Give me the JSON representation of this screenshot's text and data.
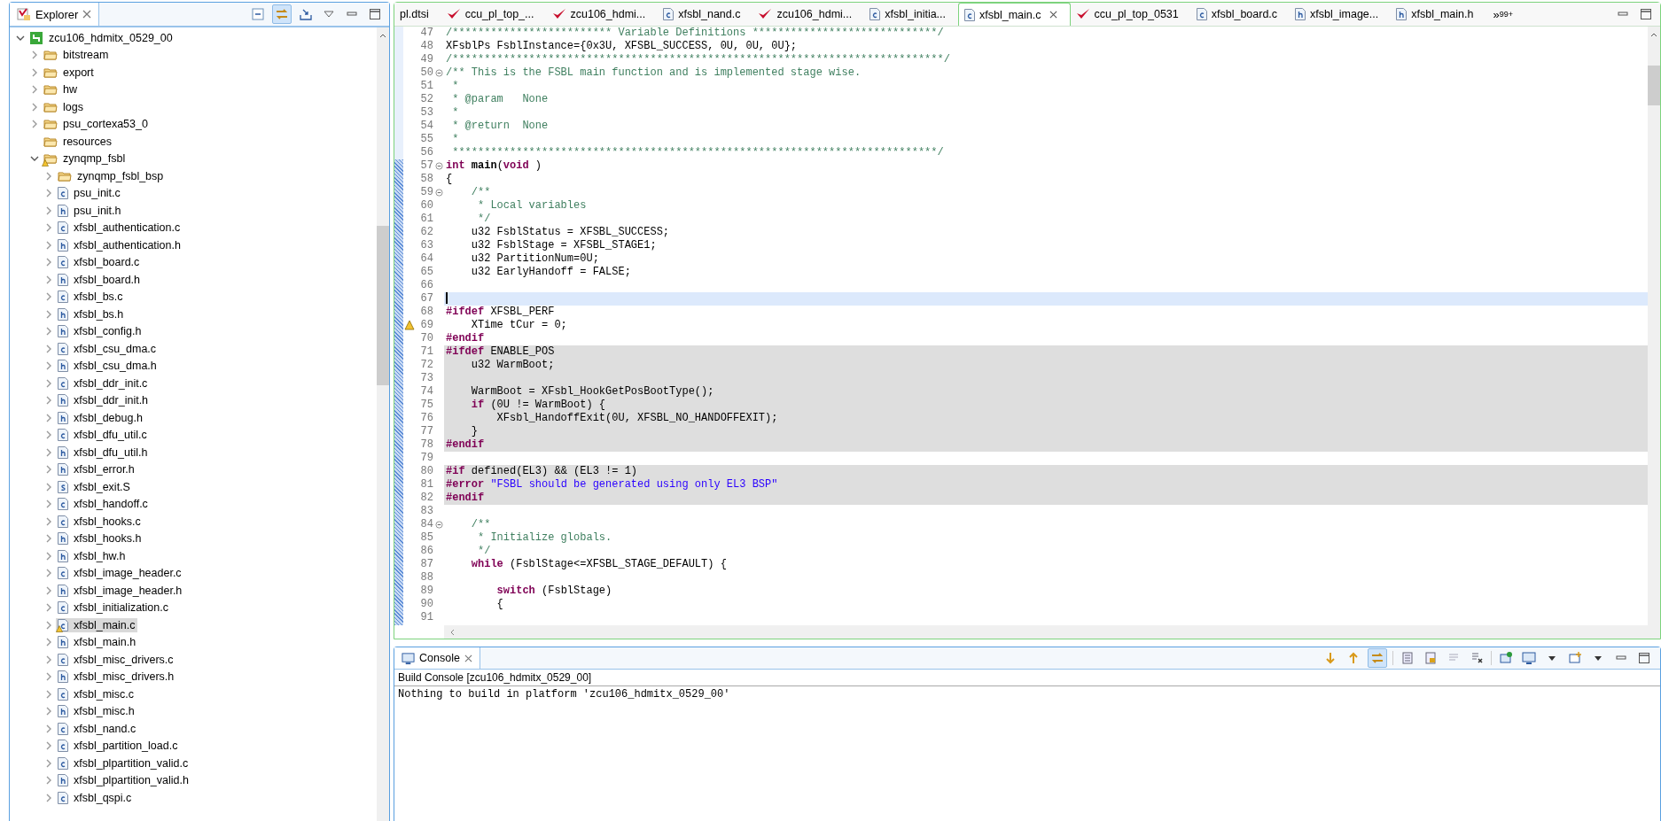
{
  "explorer": {
    "title": "Explorer",
    "tree": [
      {
        "label": "zcu106_hdmitx_0529_00",
        "kind": "project",
        "expanded": true,
        "selected": false,
        "warning": false,
        "children": [
          {
            "label": "bitstream",
            "kind": "folder",
            "expanded": false,
            "selected": false,
            "warning": false
          },
          {
            "label": "export",
            "kind": "folder",
            "expanded": false,
            "selected": false,
            "warning": false
          },
          {
            "label": "hw",
            "kind": "folder",
            "expanded": false,
            "selected": false,
            "warning": false
          },
          {
            "label": "logs",
            "kind": "folder",
            "expanded": false,
            "selected": false,
            "warning": false
          },
          {
            "label": "psu_cortexa53_0",
            "kind": "folder",
            "expanded": false,
            "selected": false,
            "warning": false
          },
          {
            "label": "resources",
            "kind": "folder",
            "selected": false,
            "warning": false
          },
          {
            "label": "zynqmp_fsbl",
            "kind": "folder",
            "expanded": true,
            "selected": false,
            "warning": true,
            "children": [
              {
                "label": "zynqmp_fsbl_bsp",
                "kind": "folder",
                "expanded": false,
                "selected": false,
                "warning": false
              },
              {
                "label": "psu_init.c",
                "kind": "c",
                "expanded": false,
                "selected": false,
                "warning": false
              },
              {
                "label": "psu_init.h",
                "kind": "h",
                "expanded": false,
                "selected": false,
                "warning": false
              },
              {
                "label": "xfsbl_authentication.c",
                "kind": "c",
                "expanded": false,
                "selected": false,
                "warning": false
              },
              {
                "label": "xfsbl_authentication.h",
                "kind": "h",
                "expanded": false,
                "selected": false,
                "warning": false
              },
              {
                "label": "xfsbl_board.c",
                "kind": "c",
                "expanded": false,
                "selected": false,
                "warning": false
              },
              {
                "label": "xfsbl_board.h",
                "kind": "h",
                "expanded": false,
                "selected": false,
                "warning": false
              },
              {
                "label": "xfsbl_bs.c",
                "kind": "c",
                "expanded": false,
                "selected": false,
                "warning": false
              },
              {
                "label": "xfsbl_bs.h",
                "kind": "h",
                "expanded": false,
                "selected": false,
                "warning": false
              },
              {
                "label": "xfsbl_config.h",
                "kind": "h",
                "expanded": false,
                "selected": false,
                "warning": false
              },
              {
                "label": "xfsbl_csu_dma.c",
                "kind": "c",
                "expanded": false,
                "selected": false,
                "warning": false
              },
              {
                "label": "xfsbl_csu_dma.h",
                "kind": "h",
                "expanded": false,
                "selected": false,
                "warning": false
              },
              {
                "label": "xfsbl_ddr_init.c",
                "kind": "c",
                "expanded": false,
                "selected": false,
                "warning": false
              },
              {
                "label": "xfsbl_ddr_init.h",
                "kind": "h",
                "expanded": false,
                "selected": false,
                "warning": false
              },
              {
                "label": "xfsbl_debug.h",
                "kind": "h",
                "expanded": false,
                "selected": false,
                "warning": false
              },
              {
                "label": "xfsbl_dfu_util.c",
                "kind": "c",
                "expanded": false,
                "selected": false,
                "warning": false
              },
              {
                "label": "xfsbl_dfu_util.h",
                "kind": "h",
                "expanded": false,
                "selected": false,
                "warning": false
              },
              {
                "label": "xfsbl_error.h",
                "kind": "h",
                "expanded": false,
                "selected": false,
                "warning": false
              },
              {
                "label": "xfsbl_exit.S",
                "kind": "s",
                "expanded": false,
                "selected": false,
                "warning": false
              },
              {
                "label": "xfsbl_handoff.c",
                "kind": "c",
                "expanded": false,
                "selected": false,
                "warning": false
              },
              {
                "label": "xfsbl_hooks.c",
                "kind": "c",
                "expanded": false,
                "selected": false,
                "warning": false
              },
              {
                "label": "xfsbl_hooks.h",
                "kind": "h",
                "expanded": false,
                "selected": false,
                "warning": false
              },
              {
                "label": "xfsbl_hw.h",
                "kind": "h",
                "expanded": false,
                "selected": false,
                "warning": false
              },
              {
                "label": "xfsbl_image_header.c",
                "kind": "c",
                "expanded": false,
                "selected": false,
                "warning": false
              },
              {
                "label": "xfsbl_image_header.h",
                "kind": "h",
                "expanded": false,
                "selected": false,
                "warning": false
              },
              {
                "label": "xfsbl_initialization.c",
                "kind": "c",
                "expanded": false,
                "selected": false,
                "warning": false
              },
              {
                "label": "xfsbl_main.c",
                "kind": "c",
                "expanded": false,
                "selected": true,
                "warning": true
              },
              {
                "label": "xfsbl_main.h",
                "kind": "h",
                "expanded": false,
                "selected": false,
                "warning": false
              },
              {
                "label": "xfsbl_misc_drivers.c",
                "kind": "c",
                "expanded": false,
                "selected": false,
                "warning": false
              },
              {
                "label": "xfsbl_misc_drivers.h",
                "kind": "h",
                "expanded": false,
                "selected": false,
                "warning": false
              },
              {
                "label": "xfsbl_misc.c",
                "kind": "c",
                "expanded": false,
                "selected": false,
                "warning": false
              },
              {
                "label": "xfsbl_misc.h",
                "kind": "h",
                "expanded": false,
                "selected": false,
                "warning": false
              },
              {
                "label": "xfsbl_nand.c",
                "kind": "c",
                "expanded": false,
                "selected": false,
                "warning": false
              },
              {
                "label": "xfsbl_partition_load.c",
                "kind": "c",
                "expanded": false,
                "selected": false,
                "warning": false
              },
              {
                "label": "xfsbl_plpartition_valid.c",
                "kind": "c",
                "expanded": false,
                "selected": false,
                "warning": false
              },
              {
                "label": "xfsbl_plpartition_valid.h",
                "kind": "h",
                "expanded": false,
                "selected": false,
                "warning": false
              },
              {
                "label": "xfsbl_qspi.c",
                "kind": "c",
                "expanded": false,
                "selected": false,
                "warning": false
              }
            ]
          }
        ]
      }
    ]
  },
  "editor": {
    "tabs": [
      {
        "label": "pl.dtsi",
        "kind": "plain",
        "selected": false
      },
      {
        "label": "ccu_pl_top_...",
        "kind": "design",
        "selected": false
      },
      {
        "label": "zcu106_hdmi...",
        "kind": "design",
        "selected": false
      },
      {
        "label": "xfsbl_nand.c",
        "kind": "c",
        "selected": false
      },
      {
        "label": "zcu106_hdmi...",
        "kind": "design",
        "selected": false
      },
      {
        "label": "xfsbl_initia...",
        "kind": "c",
        "selected": false
      },
      {
        "label": "xfsbl_main.c",
        "kind": "c",
        "selected": true
      },
      {
        "label": "ccu_pl_top_0531",
        "kind": "design",
        "selected": false
      },
      {
        "label": "xfsbl_board.c",
        "kind": "c",
        "selected": false
      },
      {
        "label": "xfsbl_image...",
        "kind": "h",
        "selected": false
      },
      {
        "label": "xfsbl_main.h",
        "kind": "h",
        "selected": false
      }
    ],
    "overflow": {
      "mark": "»",
      "count": "99+"
    },
    "lines": [
      {
        "number": "47",
        "segments": [
          {
            "kind": "comment",
            "text": "/************************* Variable Definitions *****************************/"
          }
        ],
        "fold": false,
        "shaded": false,
        "current": false,
        "warning": false
      },
      {
        "number": "48",
        "segments": [
          {
            "kind": "plain",
            "text": "XFsblPs FsblInstance={0x3U, XFSBL_SUCCESS, 0U, 0U, 0U};"
          }
        ],
        "fold": false,
        "shaded": false,
        "current": false,
        "warning": false
      },
      {
        "number": "49",
        "segments": [
          {
            "kind": "comment",
            "text": "/*****************************************************************************/"
          }
        ],
        "fold": false,
        "shaded": false,
        "current": false,
        "warning": false
      },
      {
        "number": "50",
        "segments": [
          {
            "kind": "comment",
            "text": "/** This is the FSBL main function and is implemented stage wise."
          }
        ],
        "fold": true,
        "shaded": false,
        "current": false,
        "warning": false
      },
      {
        "number": "51",
        "segments": [
          {
            "kind": "comment",
            "text": " *"
          }
        ],
        "fold": false,
        "shaded": false,
        "current": false,
        "warning": false
      },
      {
        "number": "52",
        "segments": [
          {
            "kind": "comment",
            "text": " * @param   None"
          }
        ],
        "fold": false,
        "shaded": false,
        "current": false,
        "warning": false
      },
      {
        "number": "53",
        "segments": [
          {
            "kind": "comment",
            "text": " *"
          }
        ],
        "fold": false,
        "shaded": false,
        "current": false,
        "warning": false
      },
      {
        "number": "54",
        "segments": [
          {
            "kind": "comment",
            "text": " * @return  None"
          }
        ],
        "fold": false,
        "shaded": false,
        "current": false,
        "warning": false
      },
      {
        "number": "55",
        "segments": [
          {
            "kind": "comment",
            "text": " *"
          }
        ],
        "fold": false,
        "shaded": false,
        "current": false,
        "warning": false
      },
      {
        "number": "56",
        "segments": [
          {
            "kind": "comment",
            "text": " ****************************************************************************/"
          }
        ],
        "fold": false,
        "shaded": false,
        "current": false,
        "warning": false
      },
      {
        "number": "57",
        "segments": [
          {
            "kind": "keyword",
            "text": "int"
          },
          {
            "kind": "declaration",
            "text": " main"
          },
          {
            "kind": "plain",
            "text": "("
          },
          {
            "kind": "keyword",
            "text": "void"
          },
          {
            "kind": "plain",
            "text": " )"
          }
        ],
        "fold": true,
        "shaded": false,
        "current": false,
        "warning": false
      },
      {
        "number": "58",
        "segments": [
          {
            "kind": "plain",
            "text": "{"
          }
        ],
        "fold": false,
        "shaded": false,
        "current": false,
        "warning": false
      },
      {
        "number": "59",
        "segments": [
          {
            "kind": "comment",
            "text": "    /**"
          }
        ],
        "fold": true,
        "shaded": false,
        "current": false,
        "warning": false
      },
      {
        "number": "60",
        "segments": [
          {
            "kind": "comment",
            "text": "     * Local variables"
          }
        ],
        "fold": false,
        "shaded": false,
        "current": false,
        "warning": false
      },
      {
        "number": "61",
        "segments": [
          {
            "kind": "comment",
            "text": "     */"
          }
        ],
        "fold": false,
        "shaded": false,
        "current": false,
        "warning": false
      },
      {
        "number": "62",
        "segments": [
          {
            "kind": "plain",
            "text": "    u32 FsblStatus = XFSBL_SUCCESS;"
          }
        ],
        "fold": false,
        "shaded": false,
        "current": false,
        "warning": false
      },
      {
        "number": "63",
        "segments": [
          {
            "kind": "plain",
            "text": "    u32 FsblStage = XFSBL_STAGE1;"
          }
        ],
        "fold": false,
        "shaded": false,
        "current": false,
        "warning": false
      },
      {
        "number": "64",
        "segments": [
          {
            "kind": "plain",
            "text": "    u32 PartitionNum=0U;"
          }
        ],
        "fold": false,
        "shaded": false,
        "current": false,
        "warning": false
      },
      {
        "number": "65",
        "segments": [
          {
            "kind": "plain",
            "text": "    u32 EarlyHandoff = FALSE;"
          }
        ],
        "fold": false,
        "shaded": false,
        "current": false,
        "warning": false
      },
      {
        "number": "66",
        "fold": false,
        "shaded": false,
        "current": false,
        "warning": false
      },
      {
        "number": "67",
        "fold": false,
        "shaded": false,
        "current": true,
        "warning": false
      },
      {
        "number": "68",
        "segments": [
          {
            "kind": "directive",
            "text": "#ifdef"
          },
          {
            "kind": "plain",
            "text": " XFSBL_PERF"
          }
        ],
        "fold": false,
        "shaded": false,
        "current": false,
        "warning": false
      },
      {
        "number": "69",
        "segments": [
          {
            "kind": "plain",
            "text": "    XTime tCur = 0;"
          }
        ],
        "fold": false,
        "shaded": false,
        "current": false,
        "warning": true
      },
      {
        "number": "70",
        "segments": [
          {
            "kind": "directive",
            "text": "#endif"
          }
        ],
        "fold": false,
        "shaded": false,
        "current": false,
        "warning": false
      },
      {
        "number": "71",
        "segments": [
          {
            "kind": "directive",
            "text": "#ifdef"
          },
          {
            "kind": "plain",
            "text": " ENABLE_POS"
          }
        ],
        "fold": false,
        "shaded": true,
        "current": false,
        "warning": false
      },
      {
        "number": "72",
        "segments": [
          {
            "kind": "plain",
            "text": "    u32 WarmBoot;"
          }
        ],
        "fold": false,
        "shaded": true,
        "current": false,
        "warning": false
      },
      {
        "number": "73",
        "fold": false,
        "shaded": true,
        "current": false,
        "warning": false
      },
      {
        "number": "74",
        "segments": [
          {
            "kind": "plain",
            "text": "    WarmBoot = XFsbl_HookGetPosBootType();"
          }
        ],
        "fold": false,
        "shaded": true,
        "current": false,
        "warning": false
      },
      {
        "number": "75",
        "segments": [
          {
            "kind": "keyword",
            "text": "    if"
          },
          {
            "kind": "plain",
            "text": " (0U != WarmBoot) {"
          }
        ],
        "fold": false,
        "shaded": true,
        "current": false,
        "warning": false
      },
      {
        "number": "76",
        "segments": [
          {
            "kind": "plain",
            "text": "        XFsbl_HandoffExit(0U, XFSBL_NO_HANDOFFEXIT);"
          }
        ],
        "fold": false,
        "shaded": true,
        "current": false,
        "warning": false
      },
      {
        "number": "77",
        "segments": [
          {
            "kind": "plain",
            "text": "    }"
          }
        ],
        "fold": false,
        "shaded": true,
        "current": false,
        "warning": false
      },
      {
        "number": "78",
        "segments": [
          {
            "kind": "directive",
            "text": "#endif"
          }
        ],
        "fold": false,
        "shaded": true,
        "current": false,
        "warning": false
      },
      {
        "number": "79",
        "fold": false,
        "shaded": false,
        "current": false,
        "warning": false
      },
      {
        "number": "80",
        "segments": [
          {
            "kind": "directive",
            "text": "#if"
          },
          {
            "kind": "plain",
            "text": " defined(EL3) && (EL3 != 1)"
          }
        ],
        "fold": false,
        "shaded": true,
        "current": false,
        "warning": false
      },
      {
        "number": "81",
        "segments": [
          {
            "kind": "directive",
            "text": "#error"
          },
          {
            "kind": "string",
            "text": " \"FSBL should be generated using only EL3 BSP\""
          }
        ],
        "fold": false,
        "shaded": true,
        "current": false,
        "warning": false
      },
      {
        "number": "82",
        "segments": [
          {
            "kind": "directive",
            "text": "#endif"
          }
        ],
        "fold": false,
        "shaded": true,
        "current": false,
        "warning": false
      },
      {
        "number": "83",
        "fold": false,
        "shaded": false,
        "current": false,
        "warning": false
      },
      {
        "number": "84",
        "segments": [
          {
            "kind": "comment",
            "text": "    /**"
          }
        ],
        "fold": true,
        "shaded": false,
        "current": false,
        "warning": false
      },
      {
        "number": "85",
        "segments": [
          {
            "kind": "comment",
            "text": "     * Initialize globals."
          }
        ],
        "fold": false,
        "shaded": false,
        "current": false,
        "warning": false
      },
      {
        "number": "86",
        "segments": [
          {
            "kind": "comment",
            "text": "     */"
          }
        ],
        "fold": false,
        "shaded": false,
        "current": false,
        "warning": false
      },
      {
        "number": "87",
        "segments": [
          {
            "kind": "keyword",
            "text": "    while"
          },
          {
            "kind": "plain",
            "text": " (FsblStage<=XFSBL_STAGE_DEFAULT) {"
          }
        ],
        "fold": false,
        "shaded": false,
        "current": false,
        "warning": false
      },
      {
        "number": "88",
        "fold": false,
        "shaded": false,
        "current": false,
        "warning": false
      },
      {
        "number": "89",
        "segments": [
          {
            "kind": "keyword",
            "text": "        switch"
          },
          {
            "kind": "plain",
            "text": " (FsblStage)"
          }
        ],
        "fold": false,
        "shaded": false,
        "current": false,
        "warning": false
      },
      {
        "number": "90",
        "segments": [
          {
            "kind": "plain",
            "text": "        {"
          }
        ],
        "fold": false,
        "shaded": false,
        "current": false,
        "warning": false
      },
      {
        "number": "91",
        "fold": false,
        "shaded": false,
        "current": false,
        "warning": false
      }
    ]
  },
  "console": {
    "title": "Console",
    "subtitle": "Build Console [zcu106_hdmitx_0529_00]",
    "output": "Nothing to build in platform 'zcu106_hdmitx_0529_00'"
  }
}
